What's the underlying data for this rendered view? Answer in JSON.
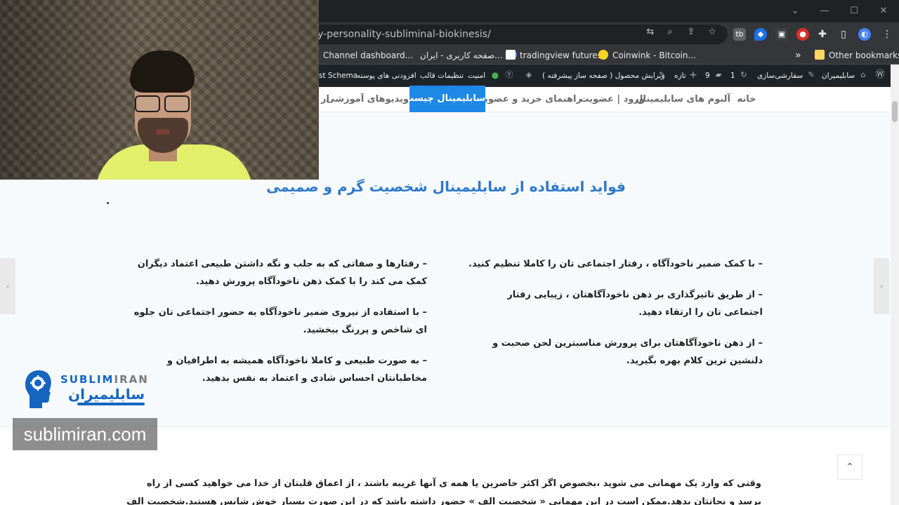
{
  "browser": {
    "url_visible": "y-personality-subliminal-biokinesis/",
    "window_controls": [
      "⌄",
      "—",
      "☐",
      "✕"
    ],
    "bookmarks": [
      {
        "label": "Channel dashboard...",
        "icon": "youtube-icon"
      },
      {
        "label": "صفحه کاربری - ایران...",
        "icon": "bookmark-globe-icon"
      },
      {
        "label": "tradingview futures",
        "icon": "tradingview-icon"
      },
      {
        "label": "Coinwink - Bitcoin...",
        "icon": "coinwink-icon"
      },
      {
        "label": "»",
        "icon": "more-bookmarks-icon"
      },
      {
        "label": "Other bookmarks",
        "icon": "folder-icon"
      }
    ]
  },
  "wp_admin_bar": {
    "site_name": "سابلیمیران",
    "customize": "سفارشی‌سازی",
    "updates_count": "1",
    "comments_count": "9",
    "new": "تازه",
    "edit_product": "ویرایش محصول ( صفحه ساز پیشرفته )",
    "security": "امنیت",
    "theme_settings": "تنظیمات قالب",
    "plugins": "افزودنی های پوسته",
    "schema": "st Schema"
  },
  "nav": {
    "items": [
      "خانه",
      "آلبوم های سابلیمینال",
      "ورود | عضویت",
      "راهنمای خرید و عضویت",
      "سابلیمینال چیست",
      "ویدیوهای آموزشی",
      "ار"
    ],
    "active_index": 4
  },
  "content": {
    "heading": "فواید استفاده از سابلیمینال شخصیت گرم و صمیمی",
    "right_col": [
      "– با کمک ضمیر ناخودآگاه ، رفتار اجتماعی تان را کاملا تنظیم کنید.",
      "– از طریق تاثیرگذاری بر ذهن ناخودآگاهتان ، زیبایی رفتار اجتماعی تان را ارتقاء دهید.",
      "– از ذهن ناخودآگاهتان برای پرورش مناسبترین لحن صحبت و دلنشین ترین کلام بهره بگیرید."
    ],
    "left_col": [
      "– رفتارها و صفاتی که به جلب و نگه داشتن طبیعی اعتماد دیگران کمک می کند را با کمک ذهن ناخودآگاه پرورش دهید.",
      "– با استفاده از نیروی ضمیر ناخودآگاه به حضور اجتماعی تان جلوه ای شاخص و پررنگ ببخشید.",
      "– به صورت طبیعی و کاملا ناخودآگاه همیشه به اطرافیان و مخاطبانتان احساس شادی و اعتماد به نفس بدهید."
    ],
    "paragraph": "وقتی که وارد یک مهمانی می شوید  ،بخصوص اگر اکثر حاضرین یا همه ی آنها غریبه باشند ، از اعماق قلبتان از خدا می خواهید کسی از راه برسد و نجاتتان بدهد.ممکن است در این مهمانی « شخصیت الف » حضور داشته باشد که در این صورت بسیار خوش شانس هستید.شخصیت الف به شما نزدیک می شود ، اگر ناآشنا باشید خودش را معرفی می کند",
    "scroll_top": "⌃"
  },
  "overlay": {
    "logo_en_blue": "SUBLIM",
    "logo_en_gray": "IRAN",
    "logo_fa": "سابلیمیران",
    "watermark": "sublimiran.com"
  },
  "colors": {
    "accent": "#1e88e5",
    "heading": "#2e79c9",
    "wp_bar": "#1d2327",
    "chrome_dark": "#35363a"
  }
}
